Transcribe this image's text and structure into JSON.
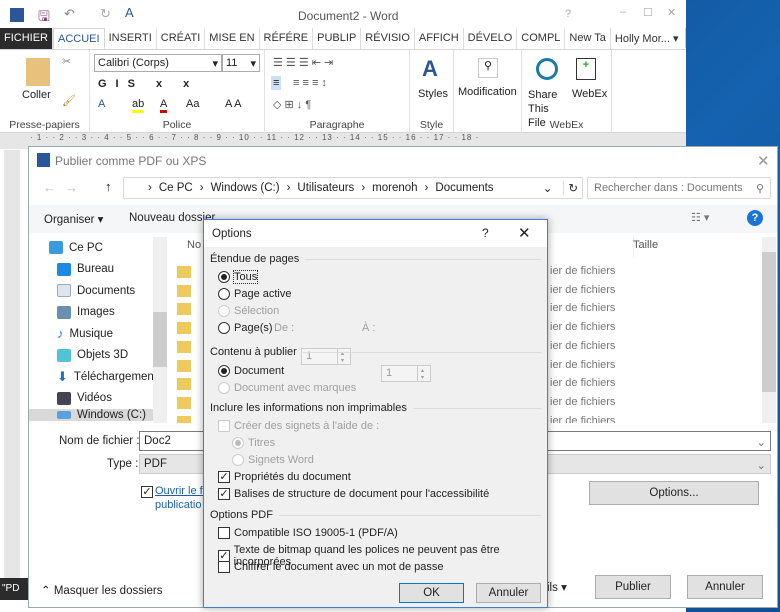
{
  "word": {
    "title": "Document2 - Word",
    "tabs": [
      "FICHIER",
      "ACCUEI",
      "INSERTI",
      "CRÉATI",
      "MISE EN",
      "RÉFÉRE",
      "PUBLIP",
      "RÉVISIO",
      "AFFICH",
      "DÉVELO",
      "COMPL",
      "New Ta"
    ],
    "user": "Holly Mor...",
    "font": "Calibri (Corps)",
    "size": "11",
    "groups": {
      "clipboard": "Presse-papiers",
      "font": "Police",
      "paragraph": "Paragraphe",
      "style": "Style",
      "webex": "WebEx"
    },
    "buttons": {
      "paste": "Coller",
      "styles": "Styles",
      "modification": "Modification",
      "share": "Share This File",
      "webex": "WebEx"
    },
    "ruler": "· 1 · · 2 · · 3 · · 4 · · 5 · · 6 · · 7 · · 8 · · 9 · · 10 · · 11 · · 12 · · 13 · · 14 · · 15 · · 16 · · 17 · · 18 ·",
    "status": "\"PD"
  },
  "publish": {
    "title": "Publier comme PDF ou XPS",
    "breadcrumb": [
      "Ce PC",
      "Windows (C:)",
      "Utilisateurs",
      "morenoh",
      "Documents"
    ],
    "search_placeholder": "Rechercher dans : Documents",
    "organize": "Organiser ▾",
    "new_folder": "Nouveau dossier",
    "nav": [
      "Ce PC",
      "Bureau",
      "Documents",
      "Images",
      "Musique",
      "Objets 3D",
      "Téléchargement",
      "Vidéos",
      "Windows (C:)"
    ],
    "columns": {
      "name": "No",
      "size": "Taille"
    },
    "file_type_text": "ier de fichiers",
    "file_rows": 9,
    "filename_label": "Nom de fichier :",
    "filename": "Doc2",
    "type_label": "Type :",
    "type": "PDF",
    "open_after": "Ouvrir le fi",
    "open_after2": "publicatio",
    "options_button": "Options...",
    "hide_folders": "Masquer les dossiers",
    "tools": "ils",
    "publish_button": "Publier",
    "cancel_button": "Annuler"
  },
  "options": {
    "title": "Options",
    "help": "?",
    "sections": {
      "range": "Étendue de pages",
      "content": "Contenu à publier",
      "nonprint": "Inclure les informations non imprimables",
      "pdf": "Options PDF"
    },
    "range": {
      "all": "Tous",
      "current": "Page active",
      "selection": "Sélection",
      "pages": "Page(s)",
      "from_label": "De :",
      "from": "1",
      "to_label": "À :",
      "to": "1"
    },
    "content": {
      "document": "Document",
      "markup": "Document avec marques"
    },
    "nonprint": {
      "bookmarks": "Créer des signets à l'aide de :",
      "headings": "Titres",
      "word_bookmarks": "Signets Word",
      "properties": "Propriétés du document",
      "tags": "Balises de structure de document pour l'accessibilité"
    },
    "pdf": {
      "iso": "Compatible ISO 19005-1 (PDF/A)",
      "bitmap": "Texte de bitmap quand les polices ne peuvent pas être incorporées",
      "encrypt": "Chiffrer le document avec un mot de passe"
    },
    "ok": "OK",
    "cancel": "Annuler"
  }
}
